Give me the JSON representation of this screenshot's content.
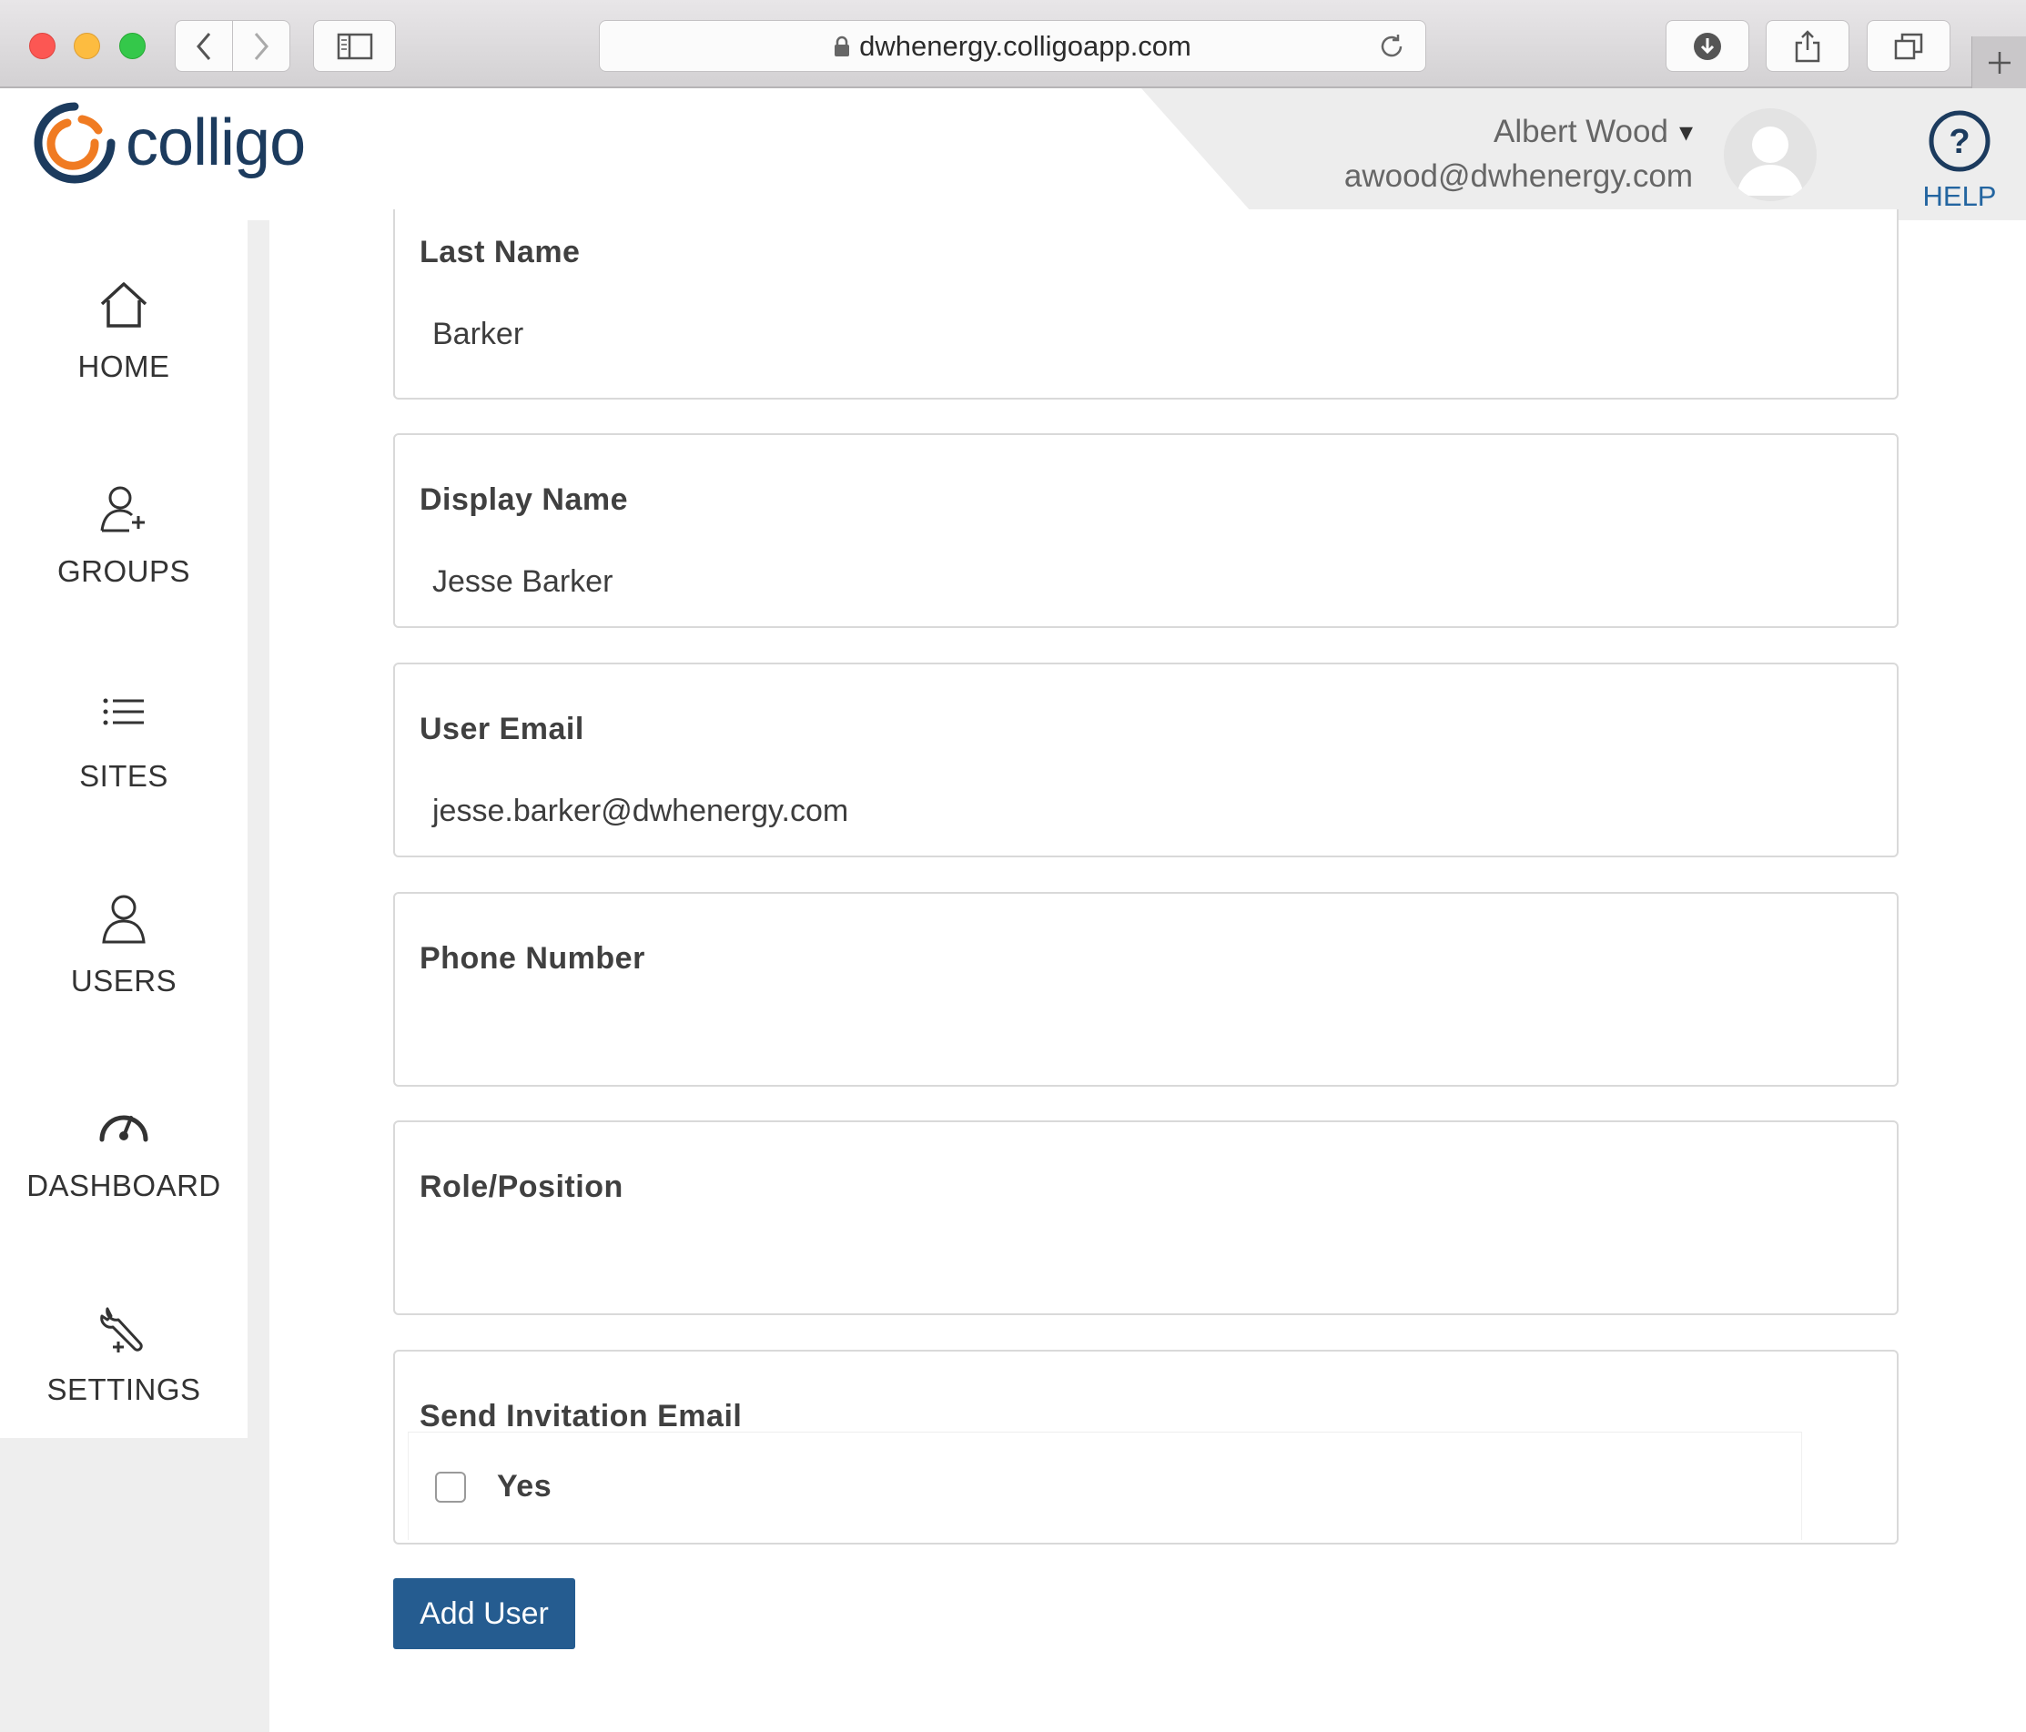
{
  "browser": {
    "url": "dwhenergy.colligoapp.com",
    "icons": [
      "back-icon",
      "forward-icon",
      "sidebar-icon",
      "lock-icon",
      "reload-icon",
      "download-icon",
      "share-icon",
      "tabs-icon",
      "plus-icon"
    ]
  },
  "header": {
    "logo_text": "colligo",
    "user_name": "Albert Wood",
    "user_dropdown_caret": "▾",
    "user_email": "awood@dwhenergy.com",
    "help_label": "HELP",
    "help_glyph": "?"
  },
  "nav": {
    "items": [
      {
        "label": "HOME",
        "icon": "home-icon"
      },
      {
        "label": "GROUPS",
        "icon": "add-user-icon"
      },
      {
        "label": "SITES",
        "icon": "list-icon"
      },
      {
        "label": "USERS",
        "icon": "user-icon"
      },
      {
        "label": "DASHBOARD",
        "icon": "gauge-icon"
      },
      {
        "label": "SETTINGS",
        "icon": "wrench-icon"
      }
    ]
  },
  "form": {
    "fields": [
      {
        "label": "Last Name",
        "value": "Barker"
      },
      {
        "label": "Display Name",
        "value": "Jesse Barker"
      },
      {
        "label": "User Email",
        "value": "jesse.barker@dwhenergy.com"
      },
      {
        "label": "Phone Number",
        "value": ""
      },
      {
        "label": "Role/Position",
        "value": ""
      }
    ],
    "invite": {
      "label": "Send Invitation Email",
      "option_label": "Yes",
      "checked": false
    },
    "submit_label": "Add User"
  },
  "colors": {
    "brand_navy": "#1c3b5e",
    "brand_orange": "#f07b22",
    "button_blue": "#255c90",
    "help_blue": "#2365a0"
  }
}
